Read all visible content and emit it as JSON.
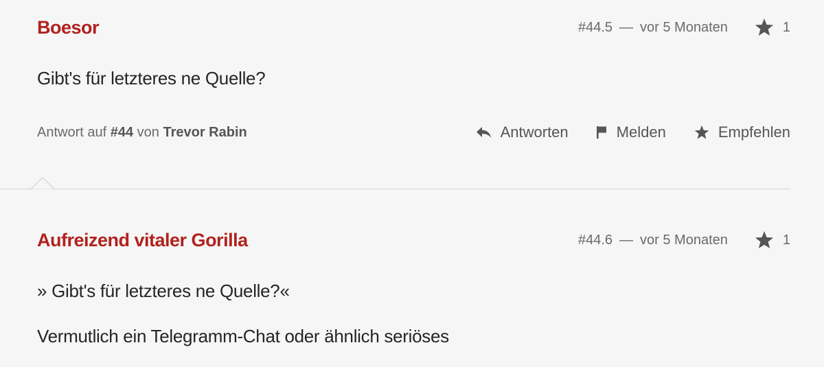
{
  "comments": [
    {
      "author": "Boesor",
      "number": "#44.5",
      "separator": "—",
      "time": "vor 5 Monaten",
      "star_count": "1",
      "paragraphs": [
        "Gibt's für letzteres ne Quelle?"
      ],
      "reply": {
        "prefix": "Antwort auf",
        "ref": "#44",
        "by": "von",
        "to_author": "Trevor Rabin"
      },
      "actions": {
        "reply_label": "Antworten",
        "report_label": "Melden",
        "recommend_label": "Empfehlen"
      }
    },
    {
      "author": "Aufreizend vitaler Gorilla",
      "number": "#44.6",
      "separator": "—",
      "time": "vor 5 Monaten",
      "star_count": "1",
      "paragraphs": [
        "» Gibt's für letzteres ne Quelle?«",
        "Vermutlich ein Telegramm-Chat oder ähnlich seriöses"
      ]
    }
  ],
  "icons": {
    "star": "star-icon",
    "reply": "reply-arrow-icon",
    "flag": "flag-icon"
  },
  "colors": {
    "author": "#b1221e",
    "meta": "#6a6a6a",
    "text": "#252525",
    "background": "#f6f6f6",
    "divider": "#d4d4d4"
  }
}
